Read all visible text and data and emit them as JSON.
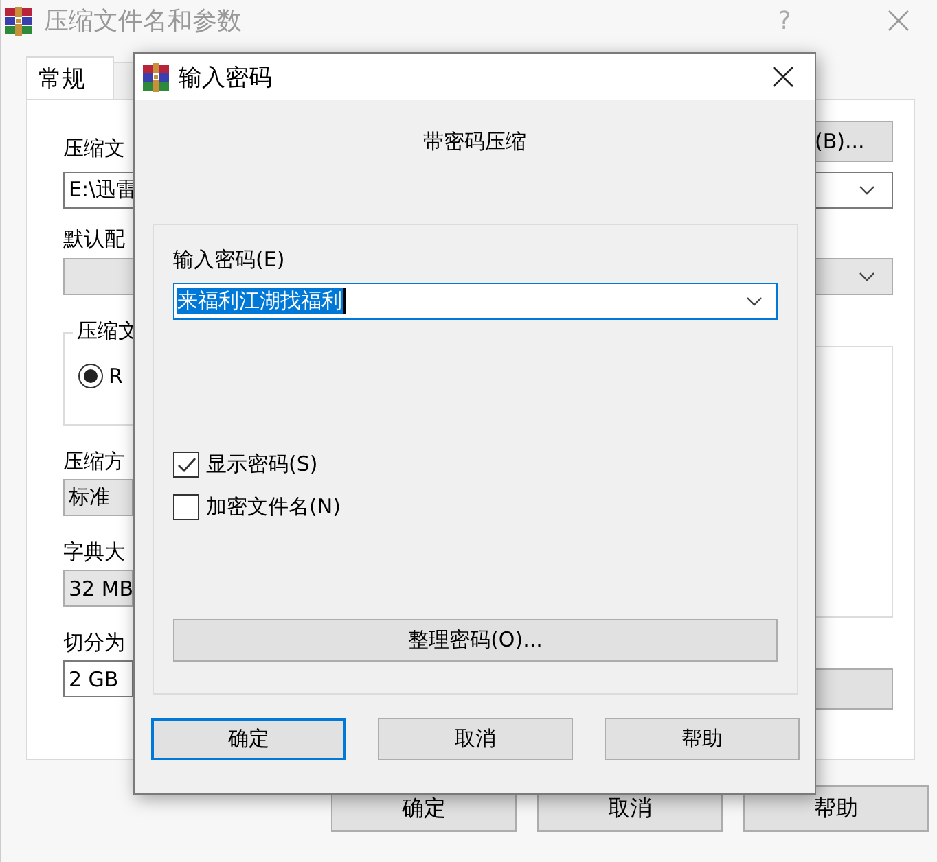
{
  "back_window": {
    "title": "压缩文件名和参数",
    "help": "?",
    "tabs": [
      {
        "label": "常规",
        "selected": true
      }
    ],
    "archive_name_label": "压缩文",
    "archive_name": "E:\\迅雷",
    "browse_button": "(B)...",
    "profile_label": "默认配",
    "format_group": "压缩文",
    "format_option": {
      "label": "R",
      "selected": true
    },
    "method_label": "压缩方",
    "method": "标准",
    "dictionary_label": "字典大",
    "dictionary": "32 MB",
    "split_label": "切分为",
    "split": "2 GB",
    "buttons": [
      "确定",
      "取消",
      "帮助"
    ]
  },
  "dialog": {
    "title": "输入密码",
    "heading": "带密码压缩",
    "password_label": "输入密码(E)",
    "password": "来福利江湖找福利",
    "options": [
      {
        "label": "显示密码(S)",
        "checked": true
      },
      {
        "label": "加密文件名(N)",
        "checked": false
      }
    ],
    "organize_button": "整理密码(O)...",
    "buttons": [
      {
        "label": "确定",
        "default": true
      },
      {
        "label": "取消",
        "default": false
      },
      {
        "label": "帮助",
        "default": false
      }
    ]
  }
}
